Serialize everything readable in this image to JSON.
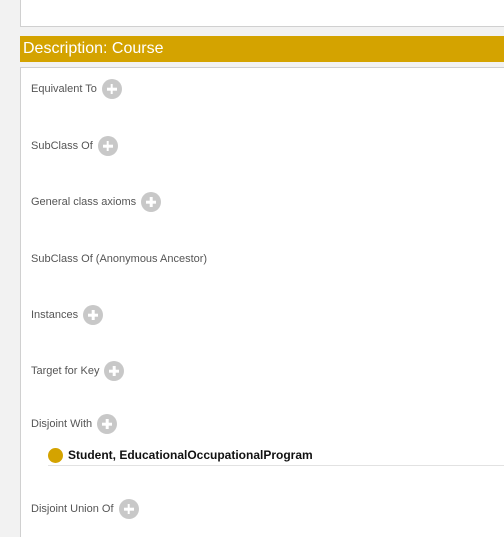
{
  "description": {
    "title": "Description: Course",
    "sections": [
      {
        "label": "Equivalent To",
        "has_add": true
      },
      {
        "label": "SubClass Of",
        "has_add": true
      },
      {
        "label": "General class axioms",
        "has_add": true
      },
      {
        "label": "SubClass Of (Anonymous Ancestor)",
        "has_add": false
      },
      {
        "label": "Instances",
        "has_add": true
      },
      {
        "label": "Target for Key",
        "has_add": true
      },
      {
        "label": "Disjoint With",
        "has_add": true
      },
      {
        "label": "Disjoint Union Of",
        "has_add": true
      }
    ],
    "disjoint_with_entries": [
      {
        "text": "Student, EducationalOccupationalProgram"
      }
    ]
  },
  "colors": {
    "header_bg": "#d4a300",
    "class_icon": "#d4a300",
    "add_button": "#c8c8c8"
  },
  "icons": {
    "add": "plus-circle-icon",
    "class": "class-circle-icon"
  }
}
